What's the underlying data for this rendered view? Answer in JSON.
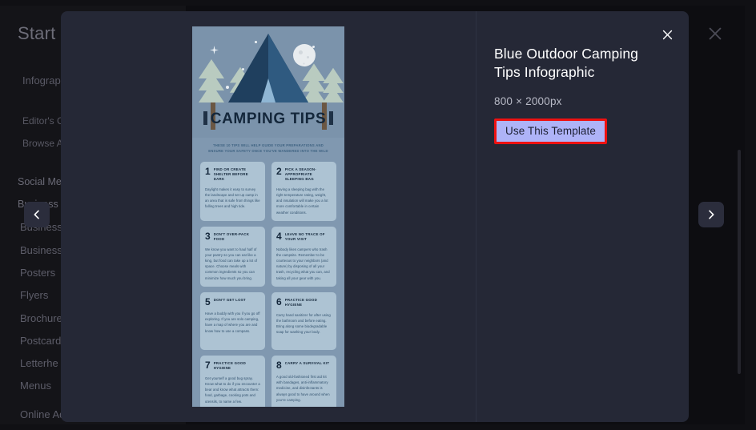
{
  "background": {
    "page_title": "Start a",
    "category_label": "Infograp",
    "links": [
      "Editor's C",
      "Browse A"
    ],
    "sections": [
      "Social Me",
      "Business"
    ],
    "items": [
      "Business",
      "Posters",
      "Flyers",
      "Brochure",
      "Postcard",
      "Letterhe",
      "Menus",
      "Online Ad"
    ],
    "close_icon": "close-icon"
  },
  "nav": {
    "prev_icon": "chevron-left-icon",
    "next_icon": "chevron-right-icon"
  },
  "modal": {
    "close_icon": "close-icon",
    "title": "Blue Outdoor Camping Tips Infographic",
    "dimensions": "800 × 2000px",
    "use_template_label": "Use This Template",
    "highlight_color": "#ee1111",
    "button_bg": "#aeb3f7",
    "panel_bg": "#252836"
  },
  "infographic": {
    "heading": "CAMPING TIPS",
    "subtitle": "THESE 10 TIPS WILL HELP GUIDE YOUR PREPARATIONS AND ENSURE YOUR SAFETY ONCE YOU'VE WANDERED INTO THE WILD",
    "sky_color": "#7b93ab",
    "card_color": "#adc3d3",
    "tent_color": "#1f3f5e",
    "tips": [
      {
        "number": "1",
        "title": "FIND OR CREATE SHELTER BEFORE DARK",
        "body": "Daylight makes it easy to survey the landscape and set up camp in an area that is safe from things like falling trees and high tide."
      },
      {
        "number": "2",
        "title": "PICK A SEASON-APPROPRIATE SLEEPING BAG",
        "body": "Having a sleeping bag with the right temperature rating, weight, and insulation will make you a lot more comfortable in certain weather conditions."
      },
      {
        "number": "3",
        "title": "DON'T OVER-PACK FOOD",
        "body": "We know you want to haul half of your pantry so you can eat like a king, but food can take up a lot of space. Choose meals with common ingredients so you can minimize how much you bring."
      },
      {
        "number": "4",
        "title": "LEAVE NO TRACE OF YOUR VISIT",
        "body": "Nobody likes campers who trash the campsite. Remember to be courteous to your neighbors (and nature) by disposing of all your trash, recycling what you can, and taking all your gear with you."
      },
      {
        "number": "5",
        "title": "DON'T GET LOST",
        "body": "Have a buddy with you if you go off exploring. If you are solo camping, have a map of where you are and know how to use a compass."
      },
      {
        "number": "6",
        "title": "PRACTICE GOOD HYGIENE",
        "body": "Carry hand sanitizer for after using the bathroom and before eating. Bring along some biodegradable soap for washing your body."
      },
      {
        "number": "7",
        "title": "PRACTICE GOOD HYGIENE",
        "body": "Get yourself a good bug spray. Know what to do if you encounter a bear and know what attracts them: food, garbage, cooking pots and utensils, to name a few."
      },
      {
        "number": "8",
        "title": "CARRY A SURVIVAL KIT",
        "body": "A good old-fashioned first aid kit with bandages, anti-inflammatory medicine, and disinfectants is always good to have around when you're camping."
      }
    ]
  }
}
